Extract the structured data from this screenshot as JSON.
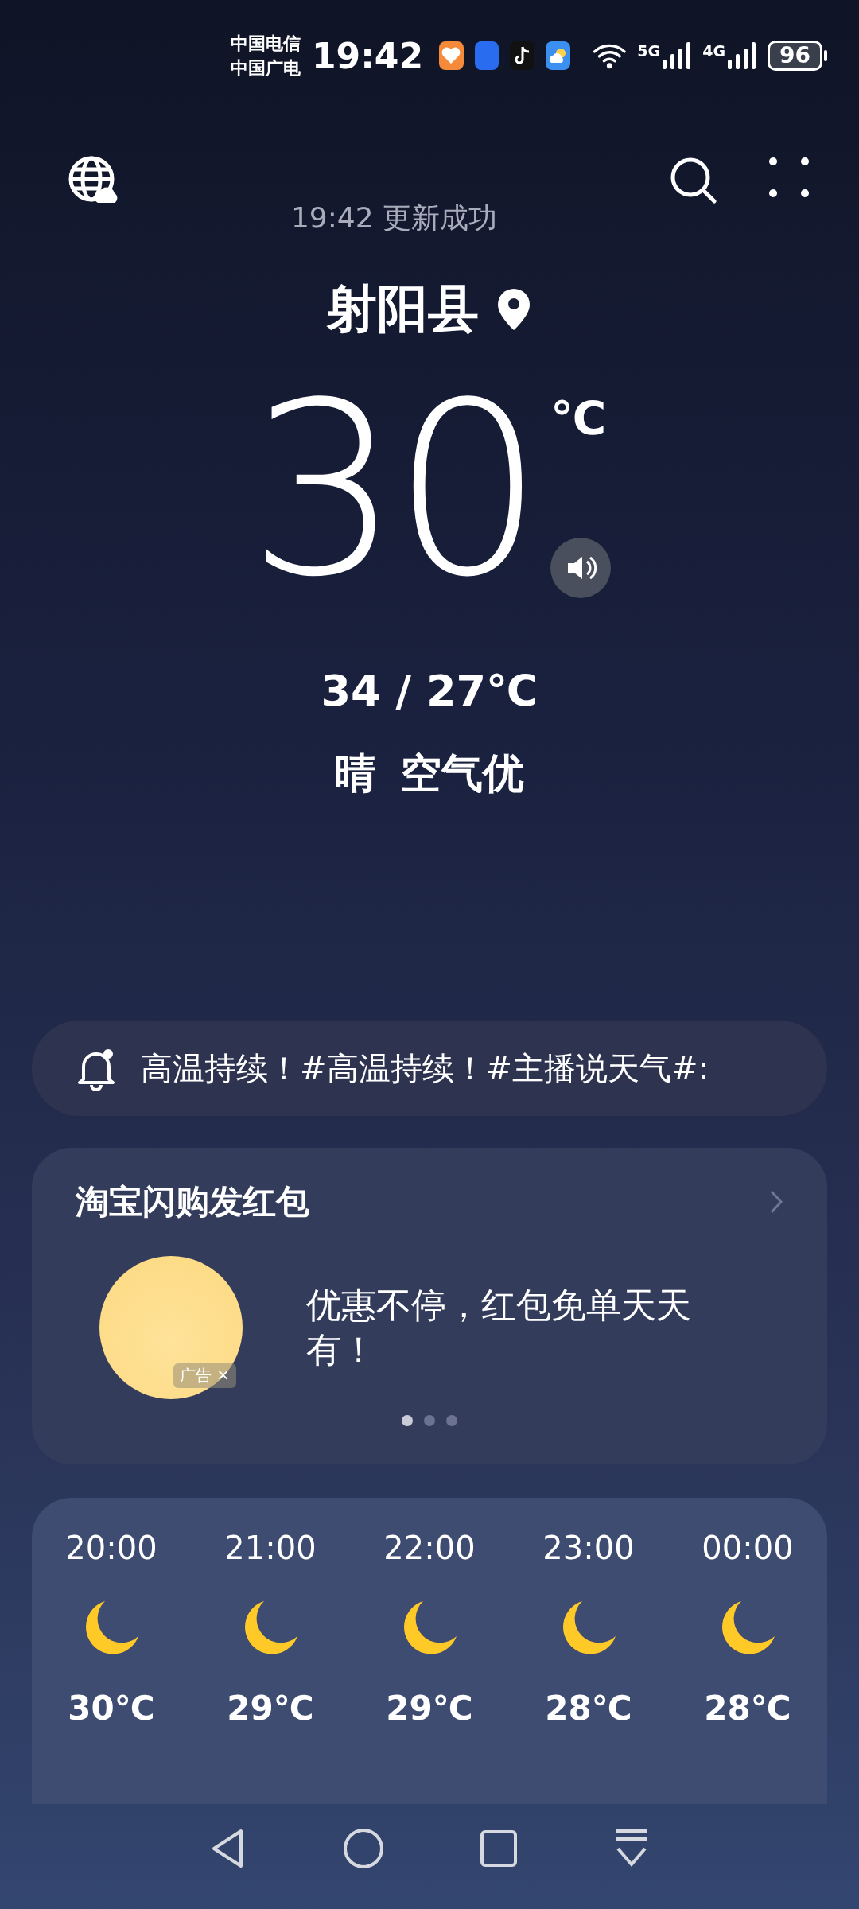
{
  "status_bar": {
    "carriers": [
      "中国电信",
      "中国广电"
    ],
    "time": "19:42",
    "battery": "96",
    "networks": [
      "5G",
      "4G"
    ]
  },
  "header": {
    "update_text": "19:42 更新成功"
  },
  "location": {
    "city": "射阳县"
  },
  "current": {
    "temperature": "30",
    "unit": "℃",
    "range": "34 / 27℃",
    "condition": "晴",
    "air_quality": "空气优"
  },
  "notice": {
    "text": "高温持续！#高温持续！#主播说天气#:"
  },
  "ad_card": {
    "title": "淘宝闪购发红包",
    "text": "优惠不停，红包免单天天有！",
    "ad_label": "广告",
    "close": "×",
    "dots": [
      {
        "selected": true
      },
      {
        "selected": false
      },
      {
        "selected": false
      }
    ]
  },
  "hourly": [
    {
      "time": "20:00",
      "temp": "30℃"
    },
    {
      "time": "21:00",
      "temp": "29℃"
    },
    {
      "time": "22:00",
      "temp": "29℃"
    },
    {
      "time": "23:00",
      "temp": "28℃"
    },
    {
      "time": "00:00",
      "temp": "28℃"
    }
  ]
}
